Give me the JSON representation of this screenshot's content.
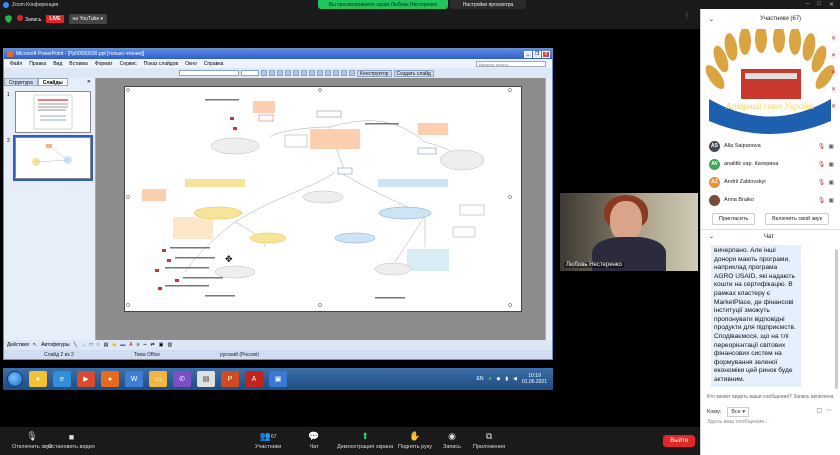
{
  "zoom_window": {
    "title": "Zoom Конференция",
    "share_banner": "Вы просматриваете экран Любовь Нестеренко",
    "view_options": "Настройки просмотра"
  },
  "meeting_top": {
    "record_label": "Запись",
    "live_label": "LIVE",
    "youtube_label": "на YouTube"
  },
  "ppt": {
    "title": "Microsoft PowerPoint - [Pp00000030.ppt [только чтение]]",
    "menu": [
      "Файл",
      "Правка",
      "Вид",
      "Вставка",
      "Формат",
      "Сервис",
      "Показ слайдов",
      "Окно",
      "Справка"
    ],
    "help_placeholder": "Введите вопрос",
    "designer_label": "Конструктор",
    "new_slide_label": "Создать слайд",
    "tabs": {
      "structure": "Структура",
      "slides": "Слайды"
    },
    "thumb_numbers": [
      "1",
      "2"
    ],
    "draw_actions": "Действия",
    "autoshapes": "Автофигуры",
    "status_slide": "Слайд 2 из 2",
    "status_theme": "Тема Office",
    "status_lang": "русский (Россия)"
  },
  "taskbar": {
    "lang": "EN",
    "time": "10:19",
    "date": "01.06.2021"
  },
  "speaker": {
    "name": "Любовь Нестеренко"
  },
  "bottom_bar": {
    "mute": "Отключить звук",
    "video": "Остановить видео",
    "participants": "Участники",
    "participants_count": "67",
    "chat": "Чат",
    "share": "Демонстрация экрана",
    "raise": "Поднять руку",
    "record": "Запись",
    "apps": "Приложения",
    "leave": "Выйти"
  },
  "participants_panel": {
    "title": "Участники",
    "count": "(67)",
    "banner_text": "Аграрний союз України",
    "items": [
      {
        "initials": "AS",
        "name": "Alla Saipanova",
        "color": "#444c55"
      },
      {
        "initials": "AV",
        "name": "analitik vap. Катерина",
        "color": "#3fa75a"
      },
      {
        "initials": "AZ",
        "name": "Andrii Zablovskyi",
        "color": "#e8913a"
      },
      {
        "initials": "",
        "name": "Anna Braiko",
        "color": "#7a4a3a"
      }
    ],
    "invite": "Пригласить",
    "unmute_all": "Включить свой звук"
  },
  "chat_panel": {
    "title": "Чат",
    "message": "вичерпано. Але інші донори мають програми, наприклад програма AGRO USAID, які надають кошти на сертифікацію. В рамках кластеру є MarketPlace, де фінансові інституції зможуть пропонувати відповідні продукти для підприємств. Сподіваємося, що на тлі переорієнтації світових фінансових систем на формування зеленої економіки цей ринок буде активним.",
    "note": "Кто может видеть ваши сообщения? Запись включена",
    "to_label": "Кому:",
    "to_value": "Все",
    "input_placeholder": "Здесь ваш сообщение..."
  },
  "icons": {
    "mic": "mic-muted-icon",
    "camera": "camera-icon",
    "people": "people-icon",
    "chat": "chat-icon",
    "share": "share-screen-icon",
    "hand": "raise-hand-icon",
    "rec": "record-icon",
    "apps": "apps-icon"
  }
}
